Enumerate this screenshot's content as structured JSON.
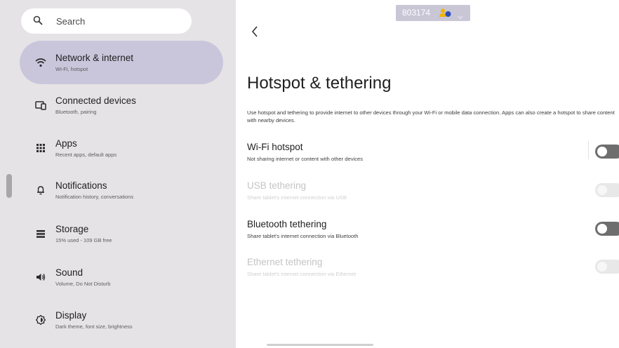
{
  "search": {
    "label": "Search"
  },
  "sidebar": {
    "items": [
      {
        "title": "Network & internet",
        "subtitle": "Wi-Fi, hotspot",
        "icon": "wifi-icon",
        "active": true
      },
      {
        "title": "Connected devices",
        "subtitle": "Bluetooth, pairing",
        "icon": "connected-devices-icon"
      },
      {
        "title": "Apps",
        "subtitle": "Recent apps, default apps",
        "icon": "apps-grid-icon"
      },
      {
        "title": "Notifications",
        "subtitle": "Notification history, conversations",
        "icon": "bell-icon"
      },
      {
        "title": "Storage",
        "subtitle": "15% used - 109 GB free",
        "icon": "storage-icon"
      },
      {
        "title": "Sound",
        "subtitle": "Volume, Do Not Disturb",
        "icon": "speaker-icon"
      },
      {
        "title": "Display",
        "subtitle": "Dark theme, font size, brightness",
        "icon": "display-icon"
      }
    ]
  },
  "top_pill": {
    "code": "803174",
    "icon": "users-icon"
  },
  "page": {
    "title": "Hotspot & tethering",
    "description": "Use hotspot and tethering to provide internet to other devices through your Wi-Fi or mobile data connection. Apps can also create a hotspot to share content with nearby devices."
  },
  "prefs": [
    {
      "title": "Wi-Fi hotspot",
      "subtitle": "Not sharing internet or content with other devices",
      "enabled": true,
      "checked": false
    },
    {
      "title": "USB tethering",
      "subtitle": "Share tablet's internet connection via USB",
      "enabled": false,
      "checked": false
    },
    {
      "title": "Bluetooth tethering",
      "subtitle": "Share tablet's internet connection via Bluetooth",
      "enabled": true,
      "checked": false
    },
    {
      "title": "Ethernet tethering",
      "subtitle": "Share tablet's internet connection via Ethernet",
      "enabled": false,
      "checked": false
    }
  ],
  "colors": {
    "sidebar_bg": "#e6e3e6",
    "active_item_bg": "#c9c6dc",
    "switch_track": "#6e6e6e",
    "pill_bg": "#c9c6d6",
    "users_icon": "#f2b400"
  }
}
